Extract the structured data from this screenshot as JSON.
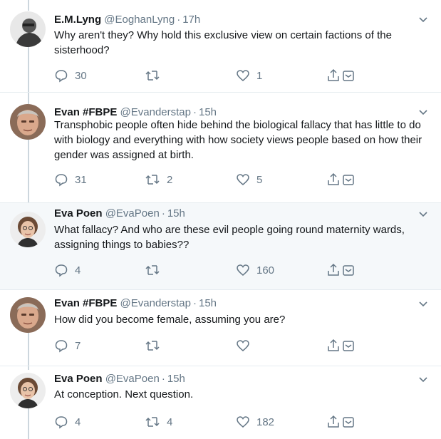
{
  "tweets": [
    {
      "name": "E.M.Lyng",
      "handle": "@EoghanLyng",
      "time": "17h",
      "text": "Why aren't they? Why hold this exclusive view on certain factions of the sisterhood?",
      "replies": "30",
      "retweets": "",
      "likes": "1"
    },
    {
      "name": "Evan #FBPE",
      "handle": "@Evanderstap",
      "time": "15h",
      "text": "Transphobic people often hide behind the biological fallacy that has little to do with biology and everything with how society views people based on how their gender was assigned at birth.",
      "replies": "31",
      "retweets": "2",
      "likes": "5"
    },
    {
      "name": "Eva Poen",
      "handle": "@EvaPoen",
      "time": "15h",
      "text": "What fallacy? And who are these evil people going round maternity wards, assigning things to babies??",
      "replies": "4",
      "retweets": "",
      "likes": "160"
    },
    {
      "name": "Evan #FBPE",
      "handle": "@Evanderstap",
      "time": "15h",
      "text": "How did you become female, assuming you are?",
      "replies": "7",
      "retweets": "",
      "likes": ""
    },
    {
      "name": "Eva Poen",
      "handle": "@EvaPoen",
      "time": "15h",
      "text": "At conception. Next question.",
      "replies": "4",
      "retweets": "4",
      "likes": "182"
    }
  ],
  "separator": "·",
  "icons": [
    "reply-icon",
    "retweet-icon",
    "like-icon",
    "share-icon",
    "direct-message-icon",
    "chevron-down-icon"
  ],
  "colors": {
    "text": "#14171a",
    "secondary": "#657786",
    "highlight_bg": "#f5f8fa",
    "border": "#e6ecf0",
    "thread_line": "#ccd6dd"
  }
}
